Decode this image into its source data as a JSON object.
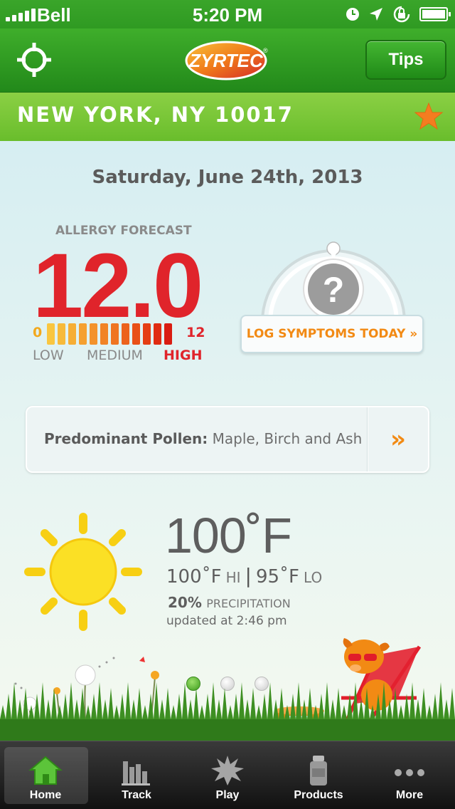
{
  "status_bar": {
    "carrier": "Bell",
    "time": "5:20 PM",
    "icons": [
      "clock-icon",
      "location-arrow-icon",
      "rotation-lock-icon",
      "battery-icon"
    ]
  },
  "nav": {
    "brand": "ZYRTEC",
    "brand_mark": "®",
    "tips_label": "Tips"
  },
  "location": {
    "title": "NEW YORK, NY 10017"
  },
  "main": {
    "date": "Saturday, June 24th, 2013",
    "forecast": {
      "label": "ALLERGY FORECAST",
      "value": "12.0",
      "scale_min": "0",
      "scale_max": "12",
      "level_low": "LOW",
      "level_medium": "MEDIUM",
      "level_high": "HIGH",
      "segment_colors": [
        "#f9c640",
        "#f7ba3a",
        "#f6ae35",
        "#f5a030",
        "#f3922b",
        "#f18326",
        "#ef7421",
        "#ec621c",
        "#e95017",
        "#e53e14",
        "#e02c12",
        "#d91d12"
      ]
    },
    "gauge_symbol": "?",
    "log_button": "LOG SYMPTOMS TODAY »",
    "pollen": {
      "label": "Predominant Pollen:",
      "value": " Maple, Birch and Ash",
      "arrow": "»"
    },
    "weather": {
      "temp": "100˚F",
      "hi": "100˚F",
      "hi_label": "HI",
      "lo": "95˚F",
      "lo_label": "LO",
      "precip_value": "20%",
      "precip_label": "PRECIPITATION",
      "updated": "updated at 2:46 pm"
    },
    "page_count": 3,
    "active_page": 1
  },
  "tabs": [
    {
      "label": "Home",
      "icon": "home-icon",
      "active": true
    },
    {
      "label": "Track",
      "icon": "bar-chart-icon",
      "active": false
    },
    {
      "label": "Play",
      "icon": "splat-icon",
      "active": false
    },
    {
      "label": "Products",
      "icon": "bottle-icon",
      "active": false
    },
    {
      "label": "More",
      "icon": "more-dots-icon",
      "active": false
    }
  ],
  "colors": {
    "brand_green": "#3fae2b",
    "forecast_red": "#e0242b",
    "accent_orange": "#f28a14"
  }
}
